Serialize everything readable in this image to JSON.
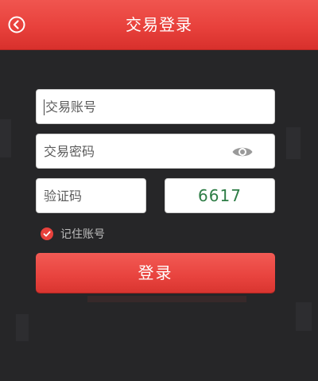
{
  "header": {
    "title": "交易登录",
    "back_icon": "chevron-left-circle-icon"
  },
  "form": {
    "account_placeholder": "交易账号",
    "password_placeholder": "交易密码",
    "password_toggle_icon": "eye-icon",
    "captcha_placeholder": "验证码",
    "captcha_code": "6617",
    "remember_label": "记住账号",
    "remember_checked": true,
    "login_label": "登录"
  },
  "colors": {
    "accent": "#e8413c",
    "background": "#262628",
    "captcha_text": "#2e7d46"
  }
}
